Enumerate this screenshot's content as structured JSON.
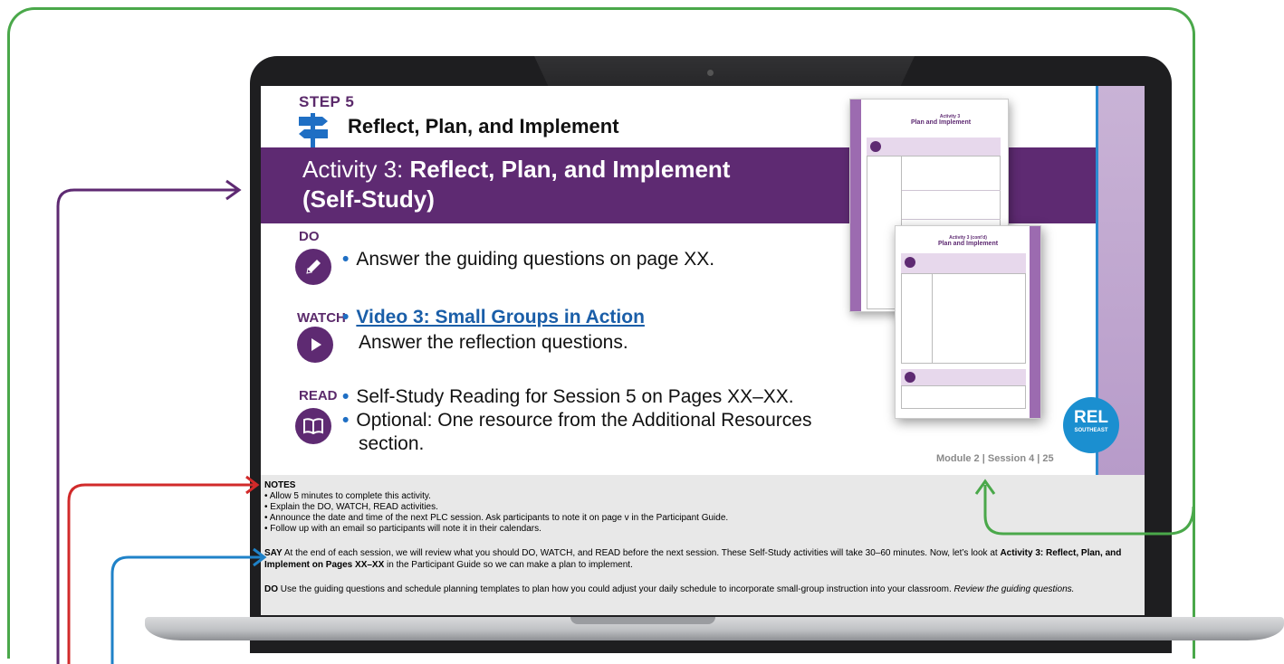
{
  "slide": {
    "step_label": "STEP 5",
    "step_title": "Reflect, Plan, and Implement",
    "banner_prefix": "Activity 3: ",
    "banner_bold_line1": "Reflect, Plan, and Implement",
    "banner_bold_line2": "(Self-Study)",
    "do": {
      "label": "DO",
      "icon": "pencil-icon",
      "bullet": "Answer the guiding questions on page XX."
    },
    "watch": {
      "label": "WATCH",
      "icon": "play-icon",
      "link": "Video 3: Small Groups in Action",
      "line2": "Answer the reflection questions."
    },
    "read": {
      "label": "READ",
      "icon": "book-icon",
      "bullet1": "Self-Study Reading for Session 5 on Pages XX–XX.",
      "bullet2_line1": "Optional: One resource from the Additional Resources",
      "bullet2_line2": "section."
    },
    "guide_back": {
      "title1": "Activity 3",
      "title2": "Plan and Implement"
    },
    "guide_front": {
      "title1": "Activity 3 (cont'd)",
      "title2": "Plan and Implement"
    },
    "logo": {
      "text": "REL",
      "sub": "SOUTHEAST"
    },
    "footer": "Module 2 | Session 4 | 25"
  },
  "notes": {
    "heading": "NOTES",
    "items": [
      "Allow 5 minutes to complete this activity.",
      "Explain the DO, WATCH, READ activities.",
      "Announce the date and time of the next PLC session. Ask participants to note it on page v in the Participant Guide.",
      "Follow up with an email so participants will note it in their calendars."
    ],
    "say_label": "SAY",
    "say_text": " At the end of each session, we will review what you should DO, WATCH, and READ before the next session. These Self-Study activities will take 30–60 minutes. Now, let’s look at ",
    "say_bold": "Activity 3: Reflect, Plan, and Implement on Pages XX–XX",
    "say_text2": " in the Participant Guide so we can make a plan to implement.",
    "do_label": "DO",
    "do_text": " Use the guiding questions and schedule planning templates to plan how you could adjust your daily schedule to incorporate small-group instruction into your classroom. ",
    "do_italic": "Review the guiding questions."
  },
  "colors": {
    "purple": "#5e2a72",
    "green_arrow": "#4aa84a",
    "purple_arrow": "#5e2a72",
    "red_arrow": "#d12a2a",
    "blue_arrow": "#1f82c8"
  }
}
